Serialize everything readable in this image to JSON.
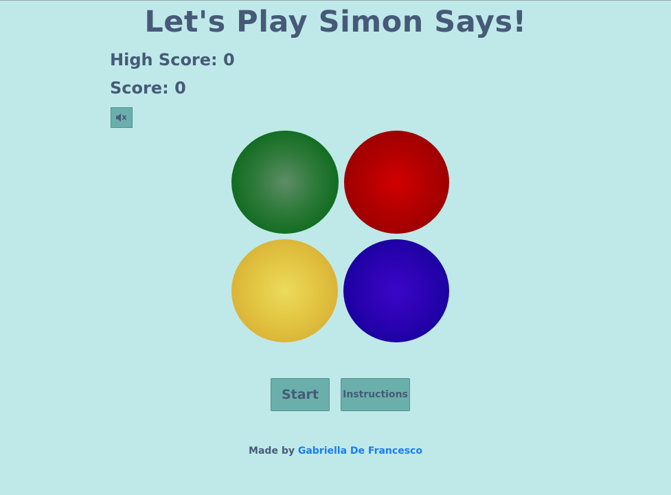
{
  "header": {
    "title": "Let's Play Simon Says!"
  },
  "scores": {
    "high_score_label": "High Score: 0",
    "score_label": "Score: 0"
  },
  "sound": {
    "icon": "volume-mute-icon",
    "muted": true
  },
  "pads": [
    {
      "color_name": "green",
      "color": "#0f6b1f"
    },
    {
      "color_name": "red",
      "color": "#990000"
    },
    {
      "color_name": "yellow",
      "color": "#d6ad33"
    },
    {
      "color_name": "blue",
      "color": "#14029a"
    }
  ],
  "controls": {
    "start_label": "Start",
    "instructions_label": "Instructions"
  },
  "footer": {
    "prefix": "Made by",
    "author_link": "Gabriella De Francesco"
  },
  "colors": {
    "background": "#bfe9e8",
    "text": "#465a78",
    "button": "#6aafab",
    "link": "#1a7df0"
  }
}
